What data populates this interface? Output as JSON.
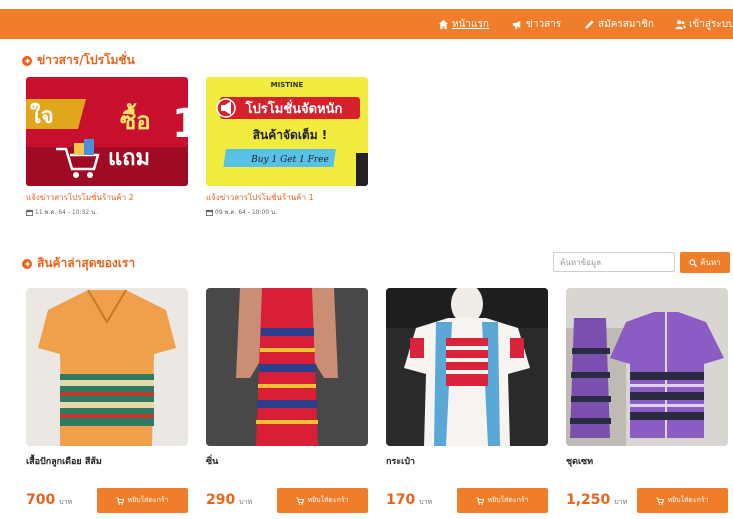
{
  "nav": {
    "home": {
      "label": "หน้าแรก",
      "icon": "home-icon"
    },
    "news": {
      "label": "ข่าวสาร",
      "icon": "megaphone-icon"
    },
    "register": {
      "label": "สมัครสมาชิก",
      "icon": "pencil-icon"
    },
    "login": {
      "label": "เข้าสู่ระบบ",
      "icon": "users-icon"
    }
  },
  "news_section": {
    "title": "ข่าวสาร/โปรโมชั่น",
    "items": [
      {
        "image_text": [
          "ใจ",
          "ซื้อ",
          "แถม",
          "1"
        ],
        "caption": "แจ้งข่าวสารโปรโมชั่นร้านค้า 2",
        "date": "11 พ.ค. 64 - 10:32 น."
      },
      {
        "image_text": [
          "MISTINE",
          "โปรโมชั่นจัดหนัก",
          "สินค้าจัดเต็ม !",
          "Buy 1 Get 1 Free"
        ],
        "caption": "แจ้งข่าวสารโปรโมชั่นร้านค้า 1",
        "date": "09 พ.ค. 64 - 10:00 น."
      }
    ]
  },
  "products_section": {
    "title": "สินค้าล่าสุดของเรา",
    "search_placeholder": "ค้นหาข้อมูล",
    "search_button": "ค้นหา",
    "items": [
      {
        "name": "เสื้อปักลูกเดือย สีส้ม",
        "price": "700",
        "unit": "บาท",
        "cart_label": "หยิบใส่ตะกร้า"
      },
      {
        "name": "ซิ่น",
        "price": "290",
        "unit": "บาท",
        "cart_label": "หยิบใส่ตะกร้า"
      },
      {
        "name": "กระเป๋า",
        "price": "170",
        "unit": "บาท",
        "cart_label": "หยิบใส่ตะกร้า"
      },
      {
        "name": "ชุดเซท",
        "price": "1,250",
        "unit": "บาท",
        "cart_label": "หยิบใส่ตะกร้า"
      }
    ]
  },
  "colors": {
    "accent": "#f07d2a",
    "accent_text": "#e8641c"
  }
}
